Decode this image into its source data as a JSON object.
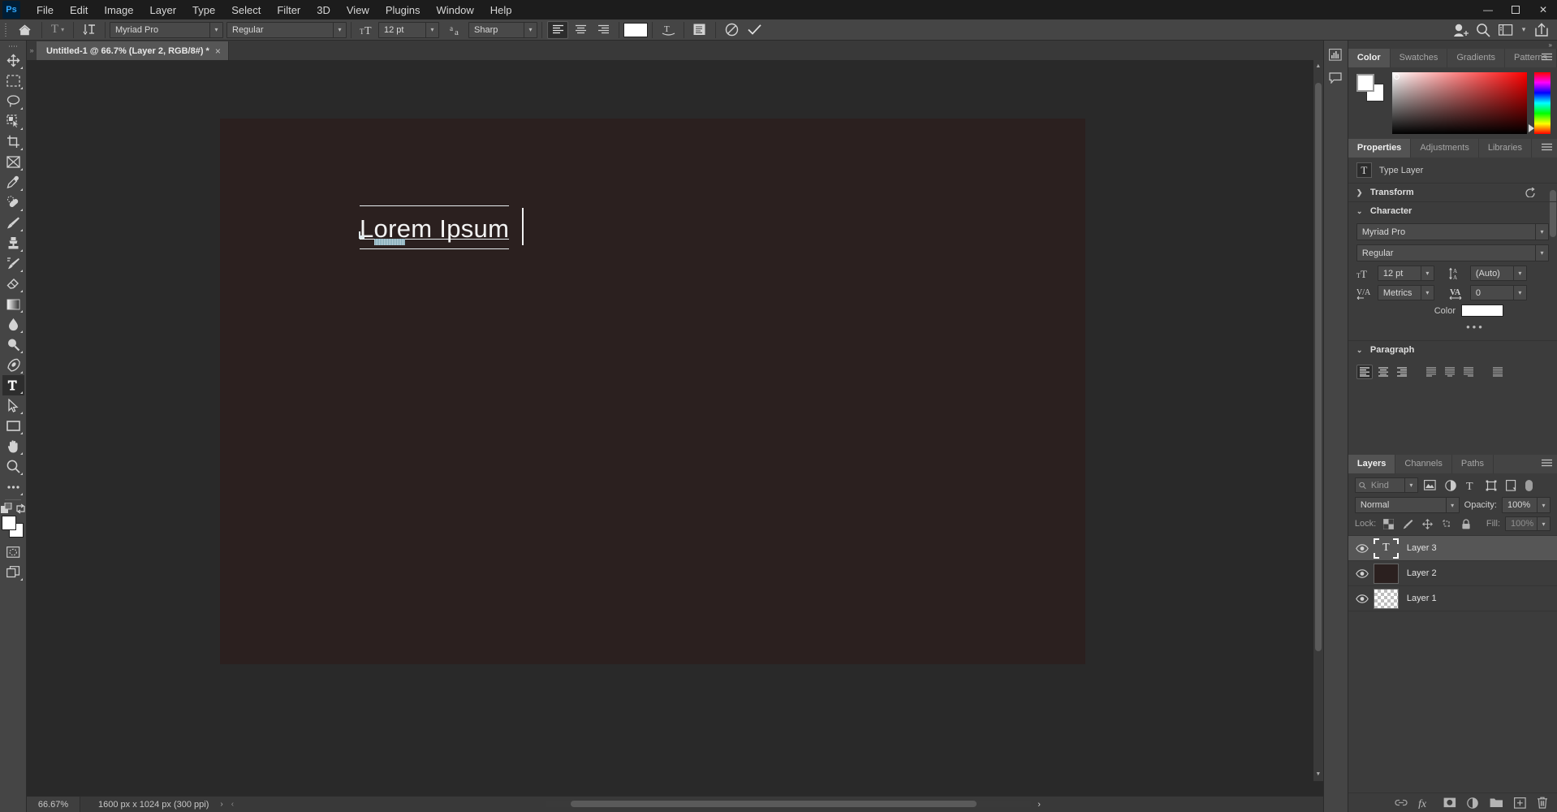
{
  "app": {
    "name": "Adobe Photoshop",
    "logo_text": "Ps"
  },
  "menubar": {
    "items": [
      {
        "label": "File"
      },
      {
        "label": "Edit"
      },
      {
        "label": "Image"
      },
      {
        "label": "Layer"
      },
      {
        "label": "Type"
      },
      {
        "label": "Select"
      },
      {
        "label": "Filter"
      },
      {
        "label": "3D"
      },
      {
        "label": "View"
      },
      {
        "label": "Plugins"
      },
      {
        "label": "Window"
      },
      {
        "label": "Help"
      }
    ],
    "window_controls": {
      "minimize": "—",
      "maximize": "❐",
      "close": "✕"
    }
  },
  "options_bar": {
    "tool_icon": "type-tool-icon",
    "orientation_label": "toggle-text-orientation",
    "font_family": {
      "value": "Myriad Pro"
    },
    "font_style": {
      "value": "Regular"
    },
    "font_size": {
      "value": "12 pt"
    },
    "antialias": {
      "value": "Sharp"
    },
    "align": [
      "align-left",
      "align-center",
      "align-right"
    ],
    "text_color": "#ffffff",
    "warp_label": "create-warped-text",
    "panel_toggle_label": "toggle-character-paragraph-panels",
    "cancel_label": "⊘",
    "commit_label": "✓",
    "right_icons": [
      "add-user-icon",
      "search-icon",
      "workspace-icon",
      "share-icon"
    ]
  },
  "toolbar": {
    "tools": [
      {
        "name": "move-tool",
        "active": false
      },
      {
        "name": "rectangular-marquee-tool",
        "active": false
      },
      {
        "name": "lasso-tool",
        "active": false
      },
      {
        "name": "object-selection-tool",
        "active": false
      },
      {
        "name": "crop-tool",
        "active": false
      },
      {
        "name": "frame-tool",
        "active": false
      },
      {
        "name": "eyedropper-tool",
        "active": false
      },
      {
        "name": "spot-healing-brush-tool",
        "active": false
      },
      {
        "name": "brush-tool",
        "active": false
      },
      {
        "name": "clone-stamp-tool",
        "active": false
      },
      {
        "name": "history-brush-tool",
        "active": false
      },
      {
        "name": "eraser-tool",
        "active": false
      },
      {
        "name": "gradient-tool",
        "active": false
      },
      {
        "name": "blur-tool",
        "active": false
      },
      {
        "name": "dodge-tool",
        "active": false
      },
      {
        "name": "pen-tool",
        "active": false
      },
      {
        "name": "horizontal-type-tool",
        "active": true
      },
      {
        "name": "path-selection-tool",
        "active": false
      },
      {
        "name": "rectangle-tool",
        "active": false
      },
      {
        "name": "hand-tool",
        "active": false
      },
      {
        "name": "zoom-tool",
        "active": false
      },
      {
        "name": "edit-toolbar-tool",
        "active": false
      }
    ],
    "foreground_color": "#ffffff",
    "background_color": "#ffffff",
    "quick_mask_label": "quick-mask-mode",
    "screen_mode_label": "change-screen-mode"
  },
  "document": {
    "tab_title": "Untitled-1 @ 66.7% (Layer 2, RGB/8#) *",
    "close_label": "×",
    "canvas_bg": "#2b201f",
    "text_content": "Lorem Ipsum"
  },
  "status_bar": {
    "zoom": "66.67%",
    "doc_info": "1600 px x 1024 px (300 ppi)",
    "expand_arrow": "›",
    "left_arrow": "‹",
    "right_arrow": "›"
  },
  "right_dock": {
    "collapse_icon": "»",
    "rail_icons": [
      "histogram-icon",
      "comments-icon"
    ],
    "color_panel": {
      "tabs": [
        {
          "label": "Color",
          "active": true
        },
        {
          "label": "Swatches",
          "active": false
        },
        {
          "label": "Gradients",
          "active": false
        },
        {
          "label": "Patterns",
          "active": false
        }
      ],
      "menu_icon": "panel-menu-icon",
      "foreground": "#ffffff",
      "background": "#ffffff",
      "picker_hue": "#ff0000"
    },
    "properties_panel": {
      "tabs": [
        {
          "label": "Properties",
          "active": true
        },
        {
          "label": "Adjustments",
          "active": false
        },
        {
          "label": "Libraries",
          "active": false
        }
      ],
      "menu_icon": "panel-menu-icon",
      "layer_kind": "Type Layer",
      "sections": {
        "transform": {
          "label": "Transform",
          "expanded": false,
          "reset_icon": "reset-icon"
        },
        "character": {
          "label": "Character",
          "expanded": true,
          "font_family": "Myriad Pro",
          "font_style": "Regular",
          "font_size": "12 pt",
          "leading": "(Auto)",
          "kerning": "Metrics",
          "tracking": "0",
          "color_label": "Color",
          "color_value": "#ffffff",
          "more_label": "•••"
        },
        "paragraph": {
          "label": "Paragraph",
          "expanded": true,
          "align_buttons": [
            {
              "name": "align-left",
              "active": true
            },
            {
              "name": "align-center",
              "active": false
            },
            {
              "name": "align-right",
              "active": false
            },
            {
              "name": "justify-last-left",
              "active": false
            },
            {
              "name": "justify-last-center",
              "active": false
            },
            {
              "name": "justify-last-right",
              "active": false
            },
            {
              "name": "justify-all",
              "active": false
            }
          ]
        }
      }
    },
    "layers_panel": {
      "tabs": [
        {
          "label": "Layers",
          "active": true
        },
        {
          "label": "Channels",
          "active": false
        },
        {
          "label": "Paths",
          "active": false
        }
      ],
      "menu_icon": "panel-menu-icon",
      "filter": {
        "value": "Kind",
        "search_icon": "search-icon"
      },
      "filter_icons": [
        "filter-pixel-icon",
        "filter-adjustment-icon",
        "filter-type-icon",
        "filter-shape-icon",
        "filter-smart-object-icon"
      ],
      "filter_toggle": "filter-enable-toggle",
      "blend_mode": "Normal",
      "opacity_label": "Opacity:",
      "opacity_value": "100%",
      "lock_label": "Lock:",
      "lock_icons": [
        "lock-transparent-pixels-icon",
        "lock-image-pixels-icon",
        "lock-position-icon",
        "lock-artboard-nesting-icon",
        "lock-all-icon"
      ],
      "fill_label": "Fill:",
      "fill_value": "100%",
      "layers": [
        {
          "name": "Layer 3",
          "type": "text",
          "visible": true,
          "selected": true,
          "thumb_glyph": "T"
        },
        {
          "name": "Layer 2",
          "type": "fill",
          "visible": true,
          "selected": false,
          "thumb_color": "#2b201f"
        },
        {
          "name": "Layer 1",
          "type": "transparent",
          "visible": true,
          "selected": false
        }
      ],
      "footer_icons": [
        "link-layers-icon",
        "layer-style-fx-icon",
        "add-layer-mask-icon",
        "adjustment-layer-icon",
        "new-group-icon",
        "new-layer-icon",
        "delete-layer-icon"
      ]
    }
  }
}
